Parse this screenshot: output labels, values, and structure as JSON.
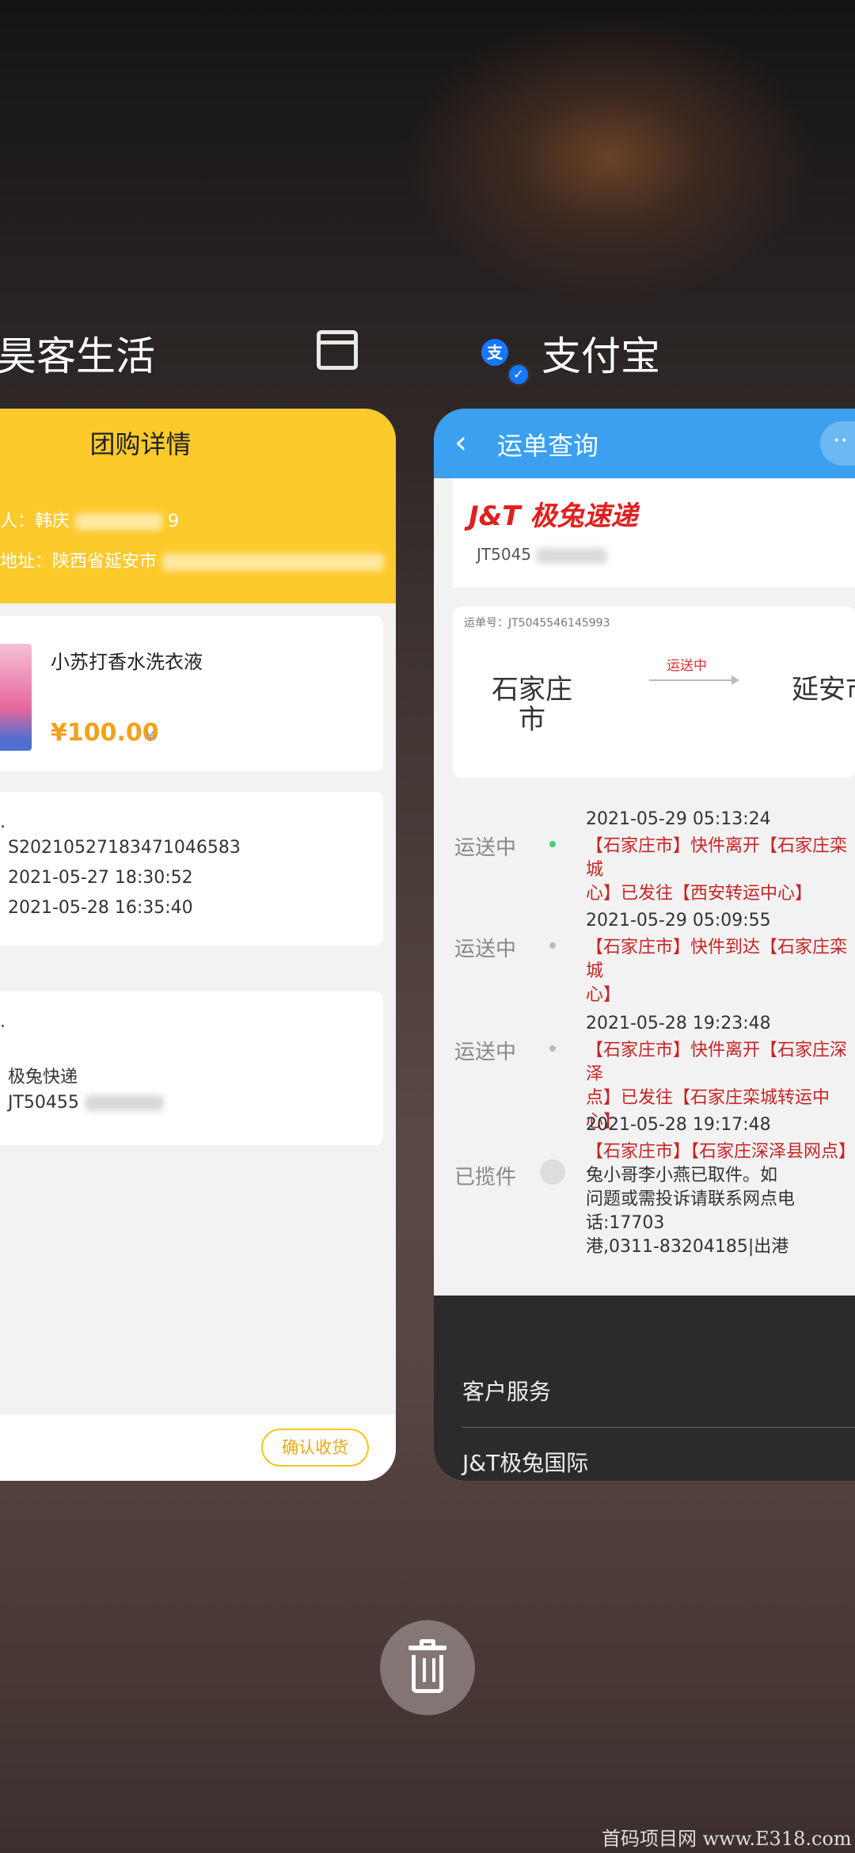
{
  "recents": {
    "left_app_title": "昊客生活",
    "right_app_title": "支付宝",
    "window_icon": "window-icon",
    "alipay_icon": "支",
    "verified_icon": "✓"
  },
  "left_card": {
    "title": "团购详情",
    "recipient_label": "人：韩庆",
    "recipient_tail": "9",
    "address_label": "地址：陕西省延安市",
    "product_name": "小苏打香水洗衣液",
    "price": "¥100.00",
    "price_unit": "¥",
    "order_number": "S20210527183471046583",
    "order_time": "2021-05-27 18:30:52",
    "ship_time": "2021-05-28 16:35:40",
    "courier": "极兔快递",
    "tracking_partial": "JT50455",
    "confirm_button": "确认收货"
  },
  "right_card": {
    "nav_title": "运单查询",
    "more_label": "··",
    "logo_text": "J&T 极兔速递",
    "tracking_partial": "JT5045",
    "route_number": "运单号：JT5045546145993",
    "from_city": "石家庄\n市",
    "to_city": "延安市",
    "route_status": "运送中",
    "timeline": [
      {
        "label": "运送中",
        "time": "2021-05-29  05:13:24",
        "desc": "【石家庄市】快件离开【石家庄栾城\n心】已发往【西安转运中心】"
      },
      {
        "label": "运送中",
        "time": "2021-05-29  05:09:55",
        "desc": "【石家庄市】快件到达【石家庄栾城\n心】"
      },
      {
        "label": "运送中",
        "time": "2021-05-28  19:23:48",
        "desc": "【石家庄市】快件离开【石家庄深泽\n点】已发往【石家庄栾城转运中心】"
      },
      {
        "label": "已揽件",
        "time": "2021-05-28  19:17:48",
        "desc_red": "【石家庄市】【石家庄深泽县网点】",
        "desc": "兔小哥李小燕已取件。如\n问题或需投诉请联系网点电话:17703\n港,0311-83204185|出港"
      }
    ],
    "footer_items": [
      "客户服务",
      "J&T极兔国际"
    ]
  },
  "actions": {
    "clear_all_icon": "trash-icon"
  },
  "watermark": "首码项目网  www.E318.com"
}
